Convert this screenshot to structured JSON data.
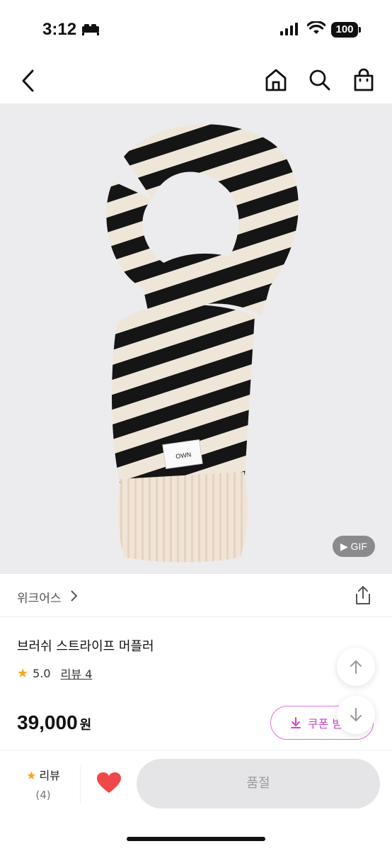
{
  "status_bar": {
    "time": "3:12",
    "battery": "100"
  },
  "product": {
    "brand": "위크어스",
    "title": "브러쉬 스트라이프 머플러",
    "rating": "5.0",
    "review_label": "리뷰 4",
    "price": "39,000",
    "currency": "원",
    "gif_badge": "GIF",
    "label_text": "OWN"
  },
  "coupon": {
    "label": "쿠폰 받"
  },
  "bottom_bar": {
    "review_label": "리뷰",
    "review_count": "(4)",
    "soldout_label": "품절"
  },
  "colors": {
    "accent": "#cc44cc",
    "star": "#f5a623",
    "heart": "#f04848"
  },
  "icons": [
    "back-icon",
    "home-icon",
    "search-icon",
    "bag-icon",
    "share-icon",
    "star-icon",
    "heart-icon",
    "arrow-up-icon",
    "arrow-down-icon"
  ]
}
